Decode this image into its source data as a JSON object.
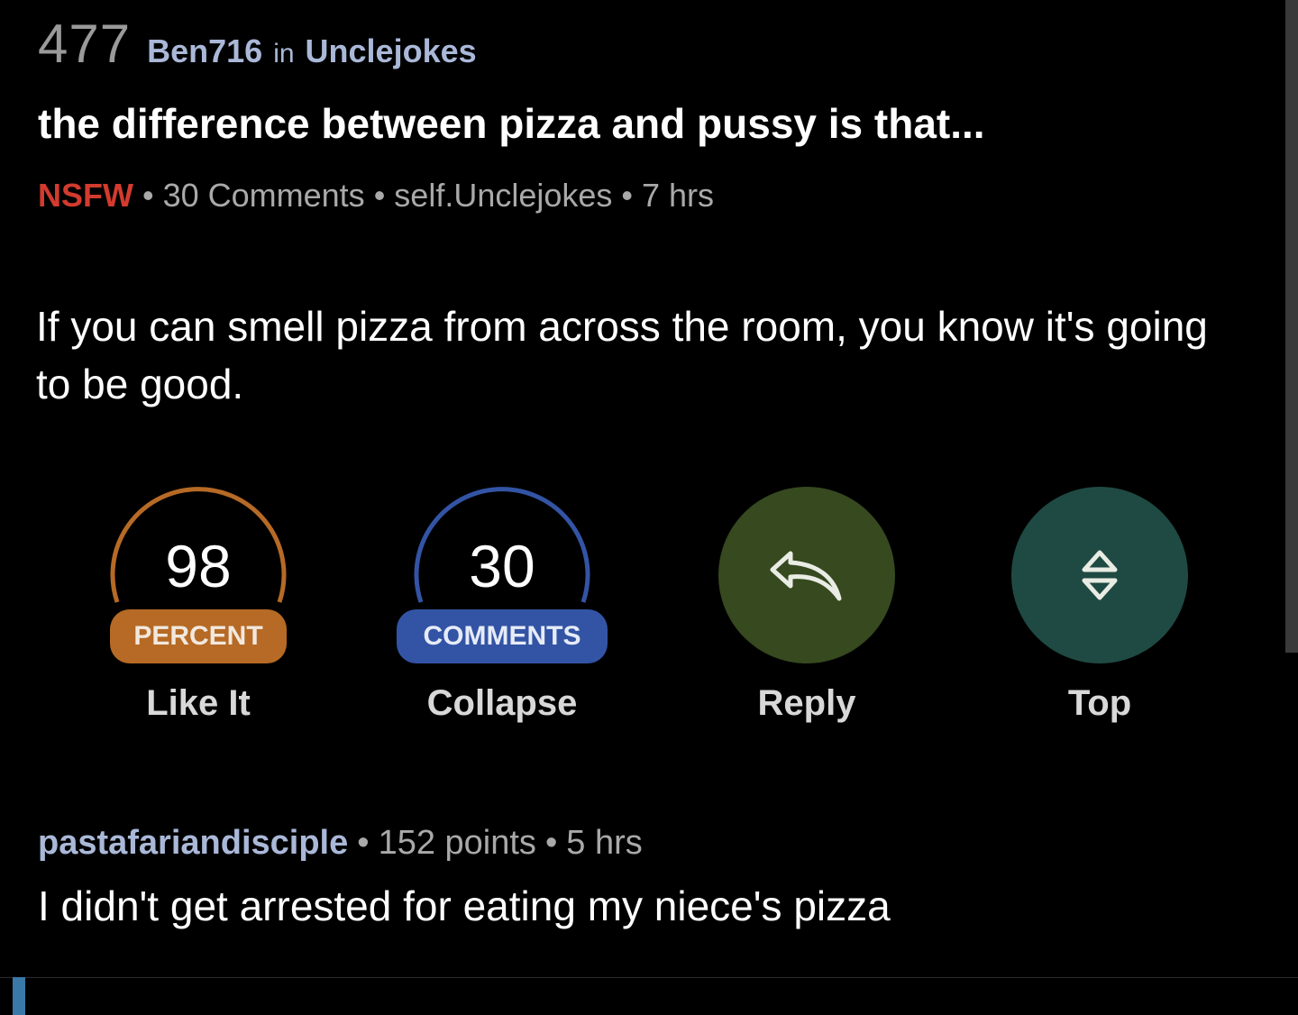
{
  "post": {
    "score": "477",
    "author": "Ben716",
    "in_word": "in",
    "subreddit": "Unclejokes",
    "title": "the difference between pizza and pussy is that...",
    "nsfw_label": "NSFW",
    "comments_count": "30 Comments",
    "domain": "self.Unclejokes",
    "age": "7 hrs",
    "separator": "•",
    "body": "If you can smell pizza from across the room, you know it's going to be good."
  },
  "actions": {
    "like": {
      "number": "98",
      "pill": "PERCENT",
      "label": "Like It",
      "percent": 98
    },
    "collapse": {
      "number": "30",
      "pill": "COMMENTS",
      "label": "Collapse"
    },
    "reply": {
      "label": "Reply",
      "icon": "reply-arrow-icon"
    },
    "top": {
      "label": "Top",
      "icon": "up-down-chevron-icon"
    }
  },
  "comment": {
    "author": "pastafariandisciple",
    "points": "152 points",
    "age": "5 hrs",
    "separator": "•",
    "text": "I didn't get arrested for eating my niece's pizza"
  },
  "colors": {
    "accent_orange": "#b66a25",
    "accent_blue": "#3354a5",
    "reply_green": "#36491f",
    "top_teal": "#1f4a43",
    "nsfw_red": "#d23b2e",
    "username_blue": "#aab8d8"
  }
}
